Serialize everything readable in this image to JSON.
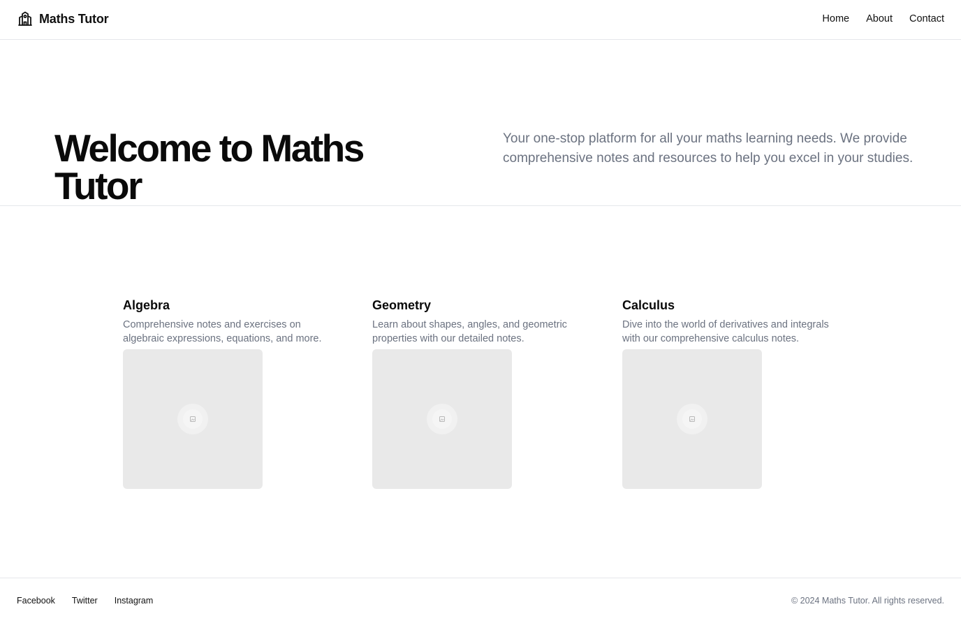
{
  "header": {
    "brand": "Maths Tutor",
    "brand_icon": "school-building-icon",
    "nav": [
      {
        "label": "Home"
      },
      {
        "label": "About"
      },
      {
        "label": "Contact"
      }
    ]
  },
  "hero": {
    "title": "Welcome to Maths Tutor",
    "description": "Your one-stop platform for all your maths learning needs. We provide comprehensive notes and resources to help you excel in your studies."
  },
  "topics": [
    {
      "title": "Algebra",
      "description": "Comprehensive notes and exercises on algebraic expressions, equations, and more.",
      "image_icon": "image-placeholder-icon"
    },
    {
      "title": "Geometry",
      "description": "Learn about shapes, angles, and geometric properties with our detailed notes.",
      "image_icon": "image-placeholder-icon"
    },
    {
      "title": "Calculus",
      "description": "Dive into the world of derivatives and integrals with our comprehensive calculus notes.",
      "image_icon": "image-placeholder-icon"
    }
  ],
  "footer": {
    "social": [
      {
        "label": "Facebook"
      },
      {
        "label": "Twitter"
      },
      {
        "label": "Instagram"
      }
    ],
    "copyright": "© 2024 Maths Tutor. All rights reserved."
  },
  "colors": {
    "text": "#111111",
    "muted": "#6b7280",
    "border": "#e5e7eb",
    "placeholder_bg": "#e9e9e9"
  }
}
